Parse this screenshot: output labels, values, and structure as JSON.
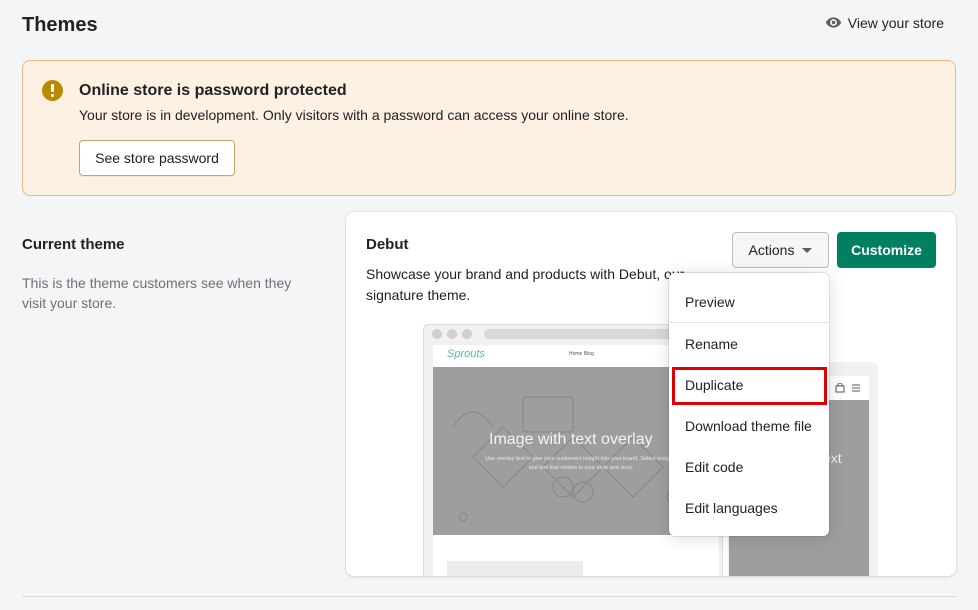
{
  "header": {
    "title": "Themes",
    "view_store_label": "View your store"
  },
  "banner": {
    "title": "Online store is password protected",
    "text": "Your store is in development. Only visitors with a password can access your online store.",
    "button_label": "See store password"
  },
  "current_theme": {
    "section_title": "Current theme",
    "section_desc": "This is the theme customers see when they visit your store.",
    "theme_name": "Debut",
    "theme_desc": "Showcase your brand and products with Debut, our signature theme.",
    "actions_label": "Actions",
    "customize_label": "Customize"
  },
  "preview": {
    "logo_text": "Sprouts",
    "nav_text": "Home  Blog",
    "hero_title": "Image with text overlay",
    "hero_sub": "Use overlay text to give your customers insight into your brand. Select imagery and text that relates to your style and story.",
    "mobile_text": "ext"
  },
  "actions_menu": {
    "items": [
      {
        "label": "Preview"
      },
      {
        "label": "Rename"
      },
      {
        "label": "Duplicate"
      },
      {
        "label": "Download theme file"
      },
      {
        "label": "Edit code"
      },
      {
        "label": "Edit languages"
      }
    ],
    "highlighted": "Duplicate"
  },
  "colors": {
    "primary": "#008060",
    "warning_bg": "#fdf1e4",
    "warning_icon": "#b98900",
    "highlight": "#e00000"
  }
}
